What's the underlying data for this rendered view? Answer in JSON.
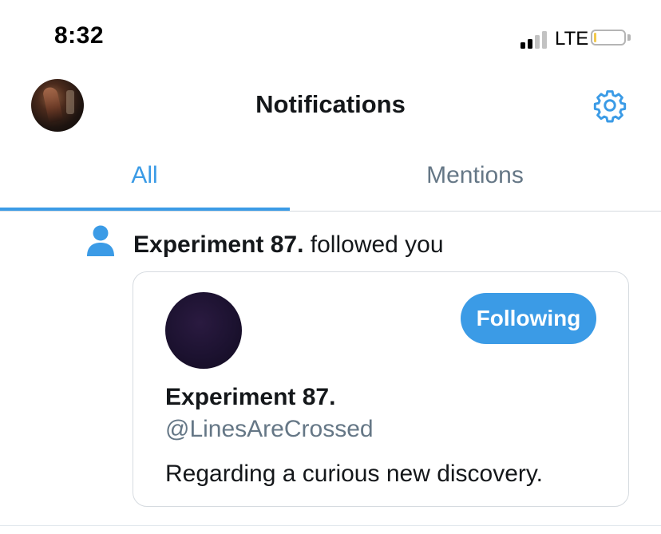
{
  "status_bar": {
    "time": "8:32",
    "network": "LTE",
    "signal_bars_filled": 2,
    "signal_bars_total": 4,
    "battery_level": 0.07
  },
  "header": {
    "title": "Notifications",
    "settings_icon": "gear-icon",
    "avatar_icon": "profile-avatar"
  },
  "tabs": [
    {
      "label": "All",
      "active": true
    },
    {
      "label": "Mentions",
      "active": false
    }
  ],
  "notification": {
    "icon": "person-icon",
    "actor": "Experiment 87.",
    "action": "followed you",
    "card": {
      "name": "Experiment 87.",
      "handle": "@LinesAreCrossed",
      "bio": "Regarding a curious new discovery.",
      "button_label": "Following"
    }
  },
  "colors": {
    "accent": "#3b9be6",
    "secondary_text": "#657786",
    "primary_text": "#14171a",
    "divider": "#d6dbe0"
  }
}
